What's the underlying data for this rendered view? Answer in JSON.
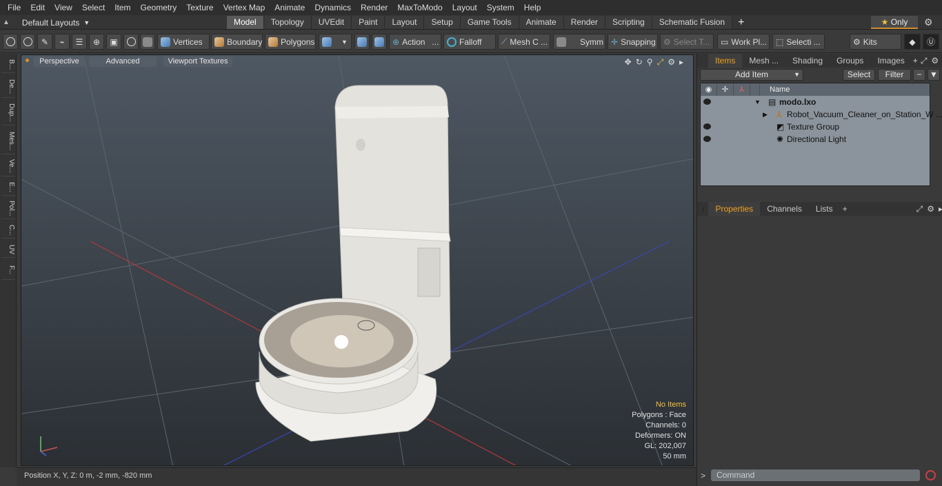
{
  "menu": [
    "File",
    "Edit",
    "View",
    "Select",
    "Item",
    "Geometry",
    "Texture",
    "Vertex Map",
    "Animate",
    "Dynamics",
    "Render",
    "MaxToModo",
    "Layout",
    "System",
    "Help"
  ],
  "layout_selector": "Default Layouts",
  "tabs": [
    "Model",
    "Topology",
    "UVEdit",
    "Paint",
    "Layout",
    "Setup",
    "Game Tools",
    "Animate",
    "Render",
    "Scripting",
    "Schematic Fusion"
  ],
  "active_tab": "Model",
  "only_label": "Only",
  "toolbar": {
    "vertices": "Vertices",
    "boundary": "Boundary",
    "polygons": "Polygons",
    "action": "Action",
    "falloff": "Falloff",
    "mesh_c": "Mesh C ...",
    "symm": "Symm ...",
    "snapping": "Snapping",
    "select_t": "Select T...",
    "work_pl": "Work Pl...",
    "selecti": "Selecti ...",
    "kits": "Kits"
  },
  "left_tabs": [
    "B...",
    "De...",
    "Dup...",
    "Mes...",
    "Ve...",
    "E...",
    "Pol...",
    "C...",
    "UV",
    "F..."
  ],
  "viewport": {
    "perspective": "Perspective",
    "advanced": "Advanced",
    "viewport_textures": "Viewport Textures",
    "stats": {
      "no_items": "No Items",
      "polygons": "Polygons : Face",
      "channels": "Channels: 0",
      "deformers": "Deformers: ON",
      "gl": "GL: 202,007",
      "scale": "50 mm"
    }
  },
  "status": {
    "position": "Position X, Y, Z:  0 m, -2 mm, -820 mm"
  },
  "right_panel": {
    "tabs": [
      "Items",
      "Mesh ...",
      "Shading",
      "Groups",
      "Images"
    ],
    "active_tab": "Items",
    "add_item": "Add Item",
    "select": "Select",
    "filter": "Filter",
    "name_col": "Name",
    "items": [
      {
        "label": "modo.lxo",
        "bold": true
      },
      {
        "label": "Robot_Vacuum_Cleaner_on_Station_W ..."
      },
      {
        "label": "Texture Group"
      },
      {
        "label": "Directional Light"
      }
    ],
    "bottom_tabs": [
      "Properties",
      "Channels",
      "Lists"
    ],
    "bottom_active": "Properties",
    "command_placeholder": "Command"
  },
  "colors": {
    "accent": "#f0a020",
    "warn": "#f0c040"
  }
}
